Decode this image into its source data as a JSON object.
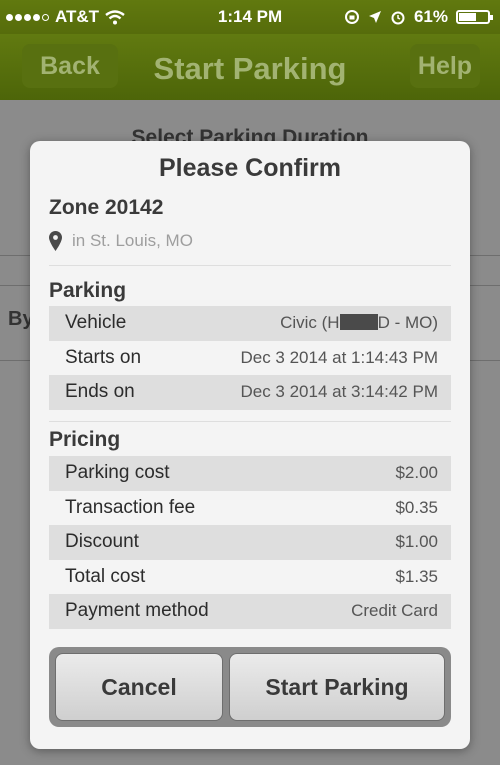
{
  "status_bar": {
    "carrier": "AT&T",
    "time": "1:14 PM",
    "battery": "61%",
    "battery_level": 0.61
  },
  "navbar": {
    "back_label": "Back",
    "title": "Start Parking",
    "help_label": "Help"
  },
  "background": {
    "heading": "Select Parking Duration",
    "partial_label": "By"
  },
  "dialog": {
    "title": "Please Confirm",
    "zone": "Zone 20142",
    "location": "in St. Louis, MO",
    "parking_section": "Parking",
    "parking_rows": [
      {
        "label": "Vehicle",
        "value_prefix": "Civic (H",
        "value_suffix": "D - MO)"
      },
      {
        "label": "Starts on",
        "value": "Dec 3 2014 at 1:14:43 PM"
      },
      {
        "label": "Ends on",
        "value": "Dec 3 2014 at 3:14:42 PM"
      }
    ],
    "pricing_section": "Pricing",
    "pricing_rows": [
      {
        "label": "Parking cost",
        "value": "$2.00"
      },
      {
        "label": "Transaction fee",
        "value": "$0.35"
      },
      {
        "label": "Discount",
        "value": "$1.00"
      },
      {
        "label": "Total cost",
        "value": "$1.35"
      },
      {
        "label": "Payment method",
        "value": "Credit Card"
      }
    ],
    "cancel_label": "Cancel",
    "start_label": "Start Parking"
  }
}
